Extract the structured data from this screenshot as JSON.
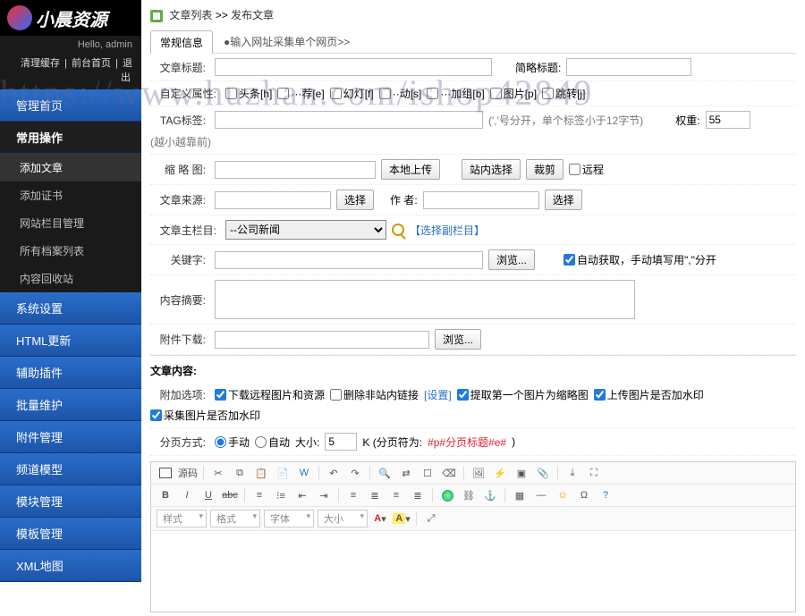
{
  "logo_text": "小晨资源",
  "hello": "Hello, admin",
  "toplinks": {
    "a": "清理缓存",
    "b": "前台首页",
    "c": "退出"
  },
  "watermark": "https://www.huzhan.com/ishop42849",
  "nav": {
    "home": "管理首页",
    "common": "常用操作",
    "add_article": "添加文章",
    "add_cert": "添加证书",
    "col_manage": "网站栏目管理",
    "archive_list": "所有档案列表",
    "recycle": "内容回收站",
    "system": "系统设置",
    "html": "HTML更新",
    "plugin": "辅助插件",
    "batch": "批量维护",
    "attach": "附件管理",
    "channel": "频道模型",
    "module": "模块管理",
    "template": "模板管理",
    "xml": "XML地图"
  },
  "breadcrumb": {
    "a": "文章列表",
    "sep": ">>",
    "b": "发布文章"
  },
  "tabs": {
    "t1": "常规信息",
    "t2": "●输入网址采集单个网页>>"
  },
  "labels": {
    "title": "文章标题:",
    "short_title": "简略标题:",
    "custom_attr": "自定义属性:",
    "tag": "TAG标签:",
    "tag_hint": "(','号分开，单个标签小于12字节)",
    "weight": "权重:",
    "weight_hint": "(越小越靠前)",
    "thumb": "缩 略 图:",
    "source": "文章来源:",
    "author": "作    者:",
    "main_col": "文章主栏目:",
    "keywords": "关键字:",
    "keywords_hint": "自动获取，手动填写用\",\"分开",
    "summary": "内容摘要:",
    "attach_dl": "附件下载:",
    "select_sub": "【选择副栏目】",
    "content_title": "文章内容:",
    "addon": "附加选项:",
    "paging": "分页方式:",
    "manual": "手动",
    "auto": "自动",
    "size": "大小:",
    "k_unit": "K (分页符为:",
    "page_tag": "#p#分页标题#e#",
    "close_paren": ")"
  },
  "attrs": {
    "a1": "头条[h]",
    "a2": "···荐[e]",
    "a3": "幻灯[f]",
    "a4": "··动[s]",
    "a5": "···加组[b]",
    "a6": "图片[p]",
    "a7": "跳转[j]"
  },
  "btns": {
    "local_upload": "本地上传",
    "site_select": "站内选择",
    "crop": "裁剪",
    "remote": "远程",
    "select": "选择",
    "browse": "浏览..."
  },
  "main_col_opt": "--公司新闻",
  "addon_opts": {
    "o1": "下载远程图片和资源",
    "o2": "删除非站内链接",
    "o2s": "[设置]",
    "o3": "提取第一个图片为缩略图",
    "o4": "上传图片是否加水印",
    "o5": "采集图片是否加水印"
  },
  "values": {
    "weight": "55",
    "page_size": "5"
  },
  "editor": {
    "source": "源码",
    "style": "样式",
    "format": "格式",
    "font": "字体",
    "size": "大小"
  }
}
